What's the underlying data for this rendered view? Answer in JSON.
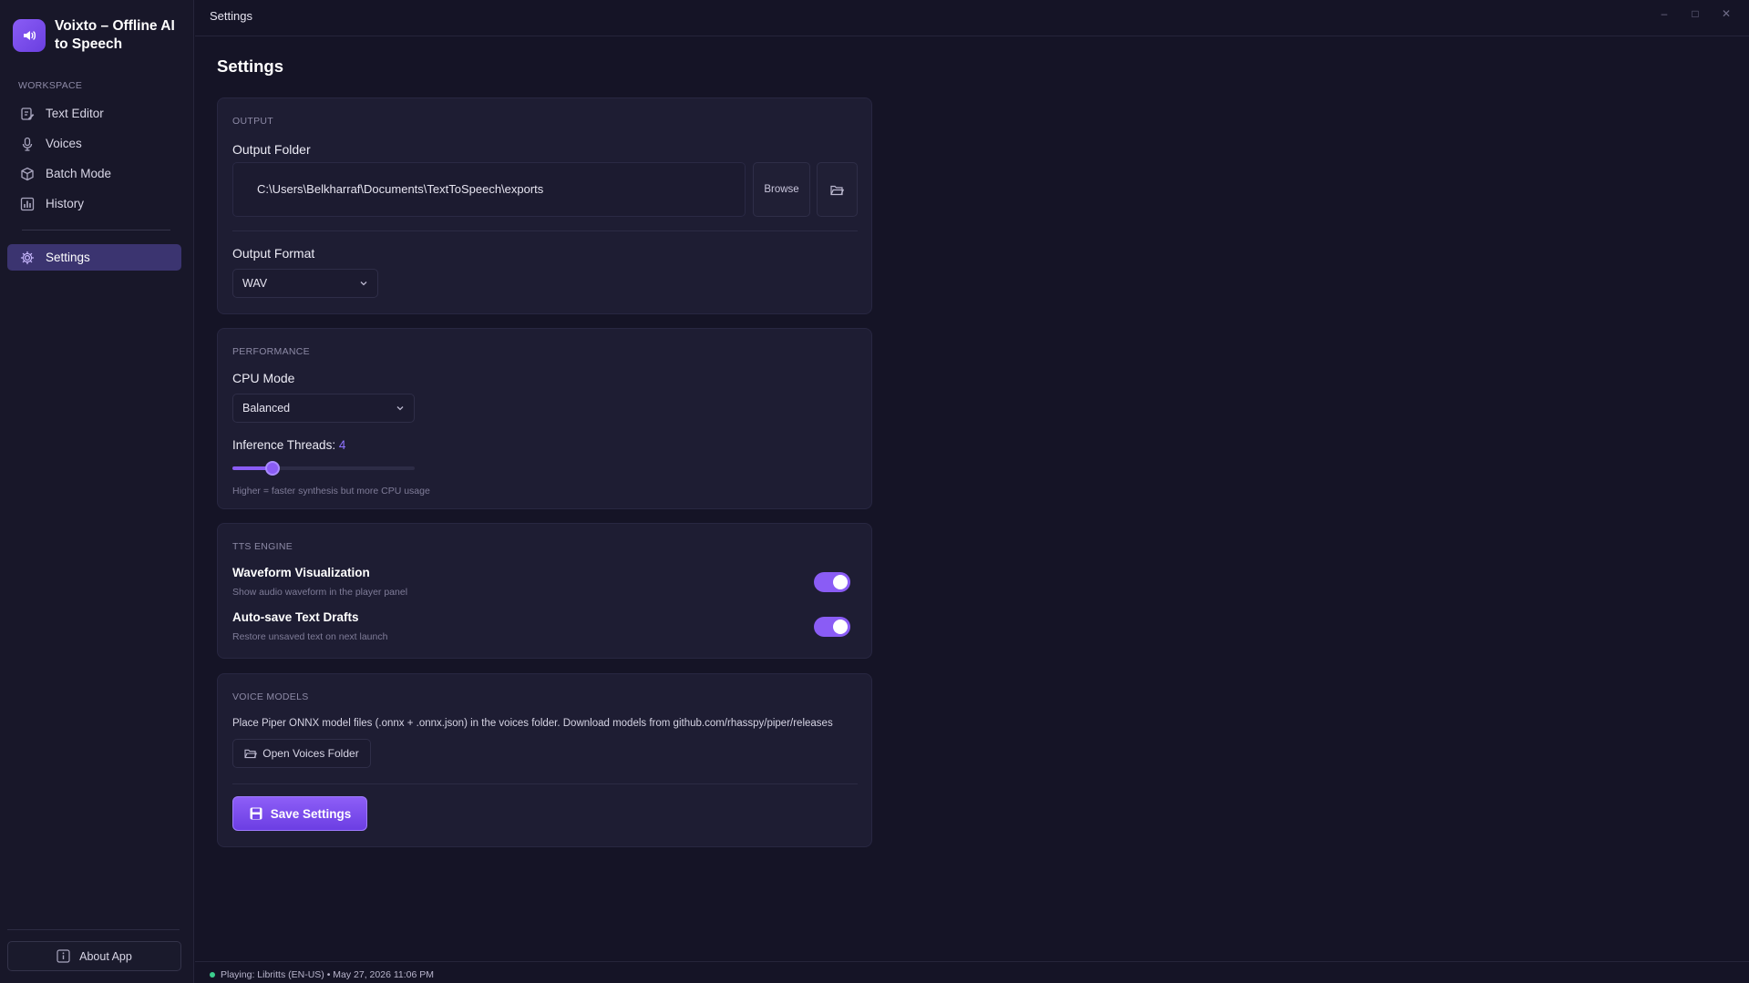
{
  "app": {
    "title": "Voixto – Offline AI to Speech",
    "window_title": "Settings",
    "window_controls": [
      "–",
      "□",
      "✕"
    ]
  },
  "sidebar": {
    "section_label": "WORKSPACE",
    "items": [
      {
        "label": "Text Editor",
        "icon": "text-editor-icon"
      },
      {
        "label": "Voices",
        "icon": "microphone-icon"
      },
      {
        "label": "Batch Mode",
        "icon": "package-icon"
      },
      {
        "label": "History",
        "icon": "chart-icon"
      },
      {
        "label": "Settings",
        "icon": "gear-icon",
        "active": true
      }
    ],
    "about_label": "About App"
  },
  "page": {
    "title": "Settings"
  },
  "output": {
    "section_label": "OUTPUT",
    "folder_label": "Output Folder",
    "folder_path": "C:\\Users\\Belkharraf\\Documents\\TextToSpeech\\exports",
    "browse_label": "Browse",
    "format_label": "Output Format",
    "format_value": "WAV"
  },
  "performance": {
    "section_label": "PERFORMANCE",
    "cpu_label": "CPU Mode",
    "cpu_value": "Balanced",
    "threads_label": "Inference Threads: ",
    "threads_value": "4",
    "threads_fraction": 0.22,
    "threads_hint": "Higher = faster synthesis but more CPU usage"
  },
  "tts": {
    "section_label": "TTS ENGINE",
    "waveform_title": "Waveform Visualization",
    "waveform_desc": "Show audio waveform in the player panel",
    "waveform_on": true,
    "autosave_title": "Auto-save Text Drafts",
    "autosave_desc": "Restore unsaved text on next launch",
    "autosave_on": true
  },
  "voice_models": {
    "section_label": "VOICE MODELS",
    "description": "Place Piper ONNX model files (.onnx + .onnx.json) in the voices folder. Download models from github.com/rhasspy/piper/releases",
    "open_folder_label": "Open Voices Folder",
    "save_label": "Save Settings"
  },
  "status": {
    "text": "Playing: Libritts (EN-US) • May 27, 2026   11:06 PM"
  },
  "colors": {
    "accent": "#8a5cf5",
    "background": "#151426",
    "card": "#1e1d33",
    "status_dot": "#3ccf8e"
  }
}
